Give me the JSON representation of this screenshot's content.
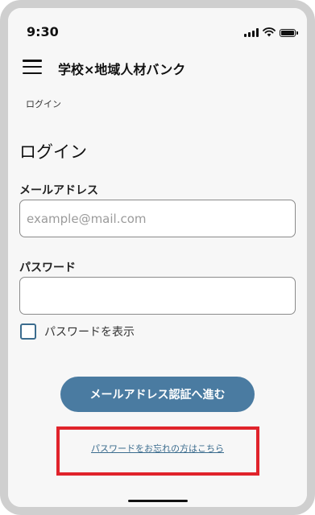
{
  "status_bar": {
    "time": "9:30",
    "icons": [
      "signal-icon",
      "wifi-icon",
      "battery-icon"
    ]
  },
  "header": {
    "menu_icon": "hamburger-menu-icon",
    "title": "学校×地域人材バンク"
  },
  "breadcrumb": "ログイン",
  "page_title": "ログイン",
  "form": {
    "email_label": "メールアドレス",
    "email_placeholder": "example@mail.com",
    "email_value": "",
    "password_label": "パスワード",
    "password_value": "",
    "show_password_label": "パスワードを表示",
    "show_password_checked": false,
    "submit_label": "メールアドレス認証へ進む",
    "forgot_password_link": "パスワードをお忘れの方はこちら"
  },
  "colors": {
    "primary_button": "#4a7ba1",
    "link": "#3b6c8e",
    "highlight_border": "#e0232b",
    "background": "#f7f7f7"
  }
}
